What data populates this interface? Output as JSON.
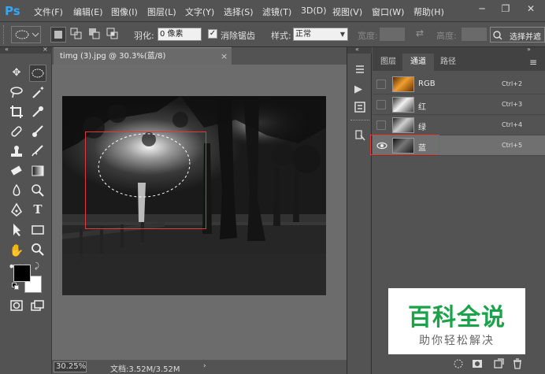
{
  "app": {
    "logo": "Ps"
  },
  "menu": [
    "文件(F)",
    "编辑(E)",
    "图像(I)",
    "图层(L)",
    "文字(Y)",
    "选择(S)",
    "滤镜(T)",
    "3D(D)",
    "视图(V)",
    "窗口(W)",
    "帮助(H)"
  ],
  "window_controls": {
    "minimize": "─",
    "restore": "❐",
    "close": "✕"
  },
  "options": {
    "feather_label": "羽化:",
    "feather_value": "0 像素",
    "antialias_label": "消除锯齿",
    "antialias_checked": true,
    "style_label": "样式:",
    "style_value": "正常",
    "width_label": "宽度:",
    "height_label": "高度:",
    "select_mask_button": "选择并遮"
  },
  "document": {
    "tab_title": "timg (3).jpg @ 30.3%(蓝/8)",
    "close": "×",
    "zoom": "30.25%",
    "doc_info": "文档:3.52M/3.52M"
  },
  "channels_panel": {
    "tabs": [
      "图层",
      "通道",
      "路径"
    ],
    "active_tab": "通道",
    "channels": [
      {
        "name": "RGB",
        "shortcut": "Ctrl+2",
        "visible": false,
        "active": false
      },
      {
        "name": "红",
        "shortcut": "Ctrl+3",
        "visible": false,
        "active": false
      },
      {
        "name": "绿",
        "shortcut": "Ctrl+4",
        "visible": false,
        "active": false
      },
      {
        "name": "蓝",
        "shortcut": "Ctrl+5",
        "visible": true,
        "active": true
      }
    ]
  },
  "watermark": {
    "title": "百科全说",
    "subtitle": "助你轻松解决"
  },
  "colors": {
    "accent_ps": "#31a8ff",
    "highlight_red": "#e53935",
    "watermark_green": "#1aa34a"
  }
}
